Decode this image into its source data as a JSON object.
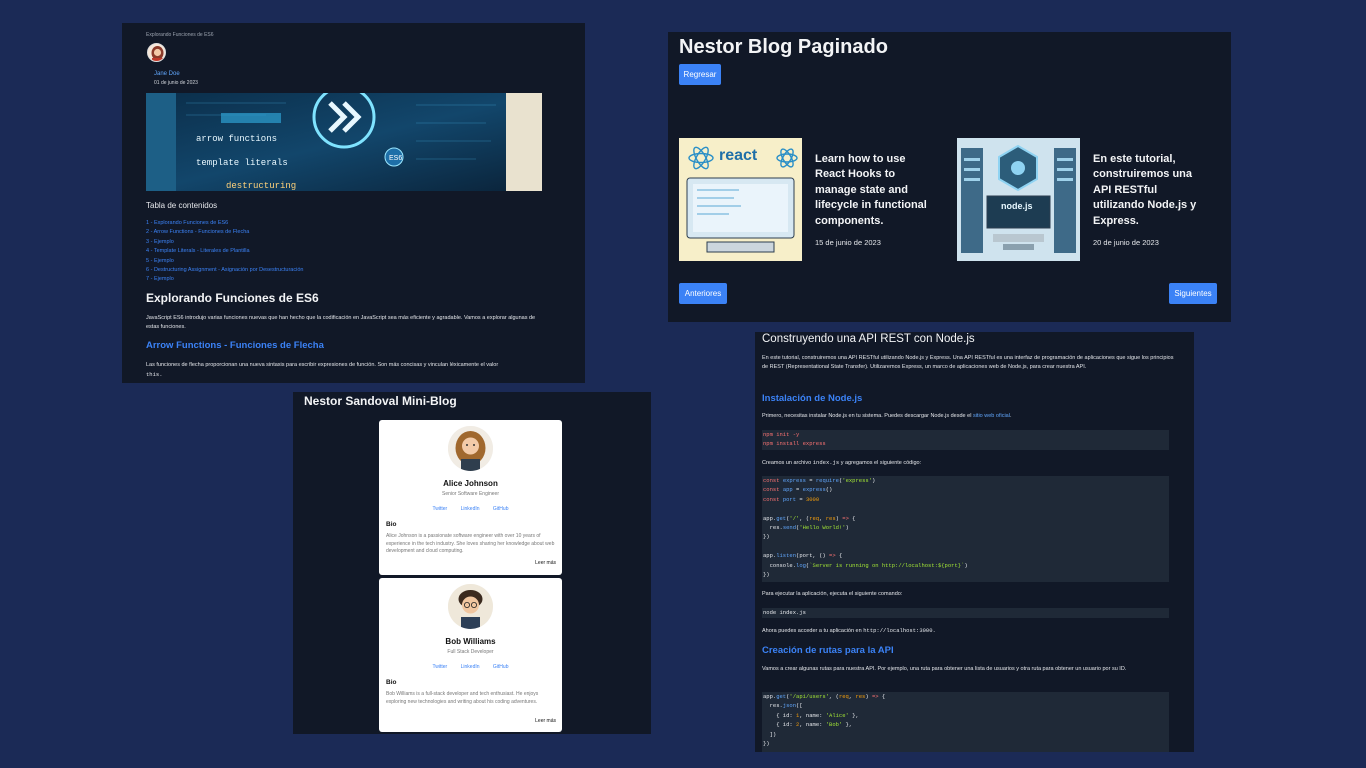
{
  "es6_article": {
    "breadcrumb": "Explorando Funciones de ES6",
    "author": "Jane Doe",
    "date": "01 de junio de 2023",
    "hero_lines": [
      "arrow functions",
      "template literals",
      "destructuring",
      "ES6"
    ],
    "toc_title": "Tabla de contenidos",
    "toc": [
      "1 - Explorando Funciones de ES6",
      "2 - Arrow Functions - Funciones de Flecha",
      "3 - Ejemplo",
      "4 - Template Literals - Literales de Plantilla",
      "5 - Ejemplo",
      "6 - Destructuring Assignment - Asignación por Desestructuración",
      "7 - Ejemplo"
    ],
    "heading": "Explorando Funciones de ES6",
    "intro": "JavaScript ES6 introdujo varias funciones nuevas que han hecho que la codificación en JavaScript sea más eficiente y agradable. Vamos a explorar algunas de estas funciones.",
    "subheading": "Arrow Functions - Funciones de Flecha",
    "para2": "Las funciones de flecha proporcionan una nueva sintaxis para escribir expresiones de función. Son más concisas y vinculan léxicamente el valor",
    "para2_code": "this."
  },
  "paginated_blog": {
    "title": "Nestor Blog Paginado",
    "back_label": "Regresar",
    "posts": [
      {
        "excerpt": "Learn how to use React Hooks to manage state and lifecycle in functional components.",
        "date": "15 de junio de 2023",
        "image_text": "react"
      },
      {
        "excerpt": "En este tutorial, construiremos una API RESTful utilizando Node.js y Express.",
        "date": "20 de junio de 2023",
        "image_text": "node.js"
      }
    ],
    "prev_label": "Anteriores",
    "next_label": "Siguientes"
  },
  "mini_blog": {
    "title": "Nestor Sandoval Mini-Blog",
    "profiles": [
      {
        "name": "Alice Johnson",
        "role": "Senior Software Engineer",
        "links": [
          "Twitter",
          "LinkedIn",
          "GitHub"
        ],
        "bio_title": "Bio",
        "bio": "Alice Johnson is a passionate software engineer with over 10 years of experience in the tech industry. She loves sharing her knowledge about web development and cloud computing.",
        "more": "Leer más"
      },
      {
        "name": "Bob Williams",
        "role": "Full Stack Developer",
        "links": [
          "Twitter",
          "LinkedIn",
          "GitHub"
        ],
        "bio_title": "Bio",
        "bio": "Bob Williams is a full-stack developer and tech enthusiast. He enjoys exploring new technologies and writing about his coding adventures.",
        "more": "Leer más"
      }
    ]
  },
  "api_article": {
    "title": "Construyendo una API REST con Node.js",
    "intro": "En este tutorial, construiremos una API RESTful utilizando Node.js y Express. Una API RESTful es una interfaz de programación de aplicaciones que sigue los principios de REST (Representational State Transfer). Utilizaremos Express, un marco de aplicaciones web de Node.js, para crear nuestra API.",
    "h_install": "Instalación de Node.js",
    "install_text": "Primero, necesitas instalar Node.js en tu sistema. Puedes descargar Node.js desde el",
    "install_link": "sitio web oficial",
    "code1": [
      "npm init -y",
      "npm install express"
    ],
    "create_text_a": "Creamos un archivo",
    "create_file": "index.js",
    "create_text_b": "y agregamos el siguiente código:",
    "run_text": "Para ejecutar la aplicación, ejecuta el siguiente comando:",
    "code_run": "node index.js",
    "access_text": "Ahora puedes acceder a tu aplicación en",
    "access_url": "http://localhost:3000.",
    "h_routes": "Creación de rutas para la API",
    "routes_text": "Vamos a crear algunas rutas para nuestra API. Por ejemplo, una ruta para obtener una lista de usuarios y otra ruta para obtener un usuario por su ID."
  }
}
